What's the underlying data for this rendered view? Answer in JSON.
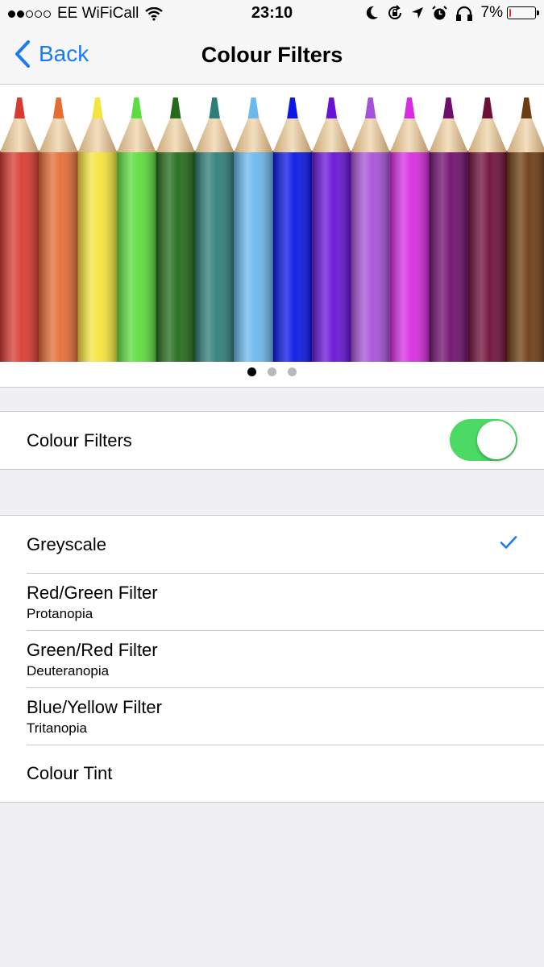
{
  "status_bar": {
    "carrier": "EE WiFiCall",
    "time": "23:10",
    "battery": "7%",
    "battery_level": 0.07,
    "signal_bars_filled": 2,
    "signal_bars_total": 5
  },
  "nav": {
    "back_label": "Back",
    "title": "Colour Filters"
  },
  "illustration": {
    "pencil_colors": [
      "#d83a32",
      "#e56c35",
      "#f5e43c",
      "#5cdc3e",
      "#236b1a",
      "#2e7d78",
      "#6ab8ec",
      "#0a17e6",
      "#6812d8",
      "#a552d8",
      "#d82ce0",
      "#6e0f6e",
      "#6e0f38",
      "#6e3c12"
    ],
    "page_count": 3,
    "active_page": 1
  },
  "filters_section": {
    "toggle_label": "Colour Filters",
    "toggle_on": true
  },
  "options": [
    {
      "label": "Greyscale",
      "sublabel": "",
      "selected": true
    },
    {
      "label": "Red/Green Filter",
      "sublabel": "Protanopia",
      "selected": false
    },
    {
      "label": "Green/Red Filter",
      "sublabel": "Deuteranopia",
      "selected": false
    },
    {
      "label": "Blue/Yellow Filter",
      "sublabel": "Tritanopia",
      "selected": false
    },
    {
      "label": "Colour Tint",
      "sublabel": "",
      "selected": false
    }
  ],
  "colors": {
    "accent": "#1a7cf5",
    "toggle_on": "#4cd964",
    "background": "#efeff4"
  }
}
